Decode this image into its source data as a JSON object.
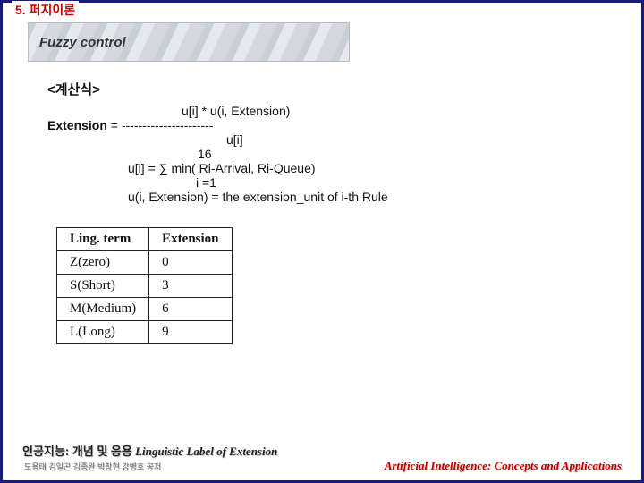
{
  "header": {
    "chapter": "5. 퍼지이론"
  },
  "banner": {
    "subtitle": "Fuzzy control"
  },
  "calc": {
    "title": "<계산식>",
    "line1": "u[i] * u(i, Extension)",
    "line2_label": "Extension",
    "line2_dashes": " = ----------------------",
    "line3": "u[i]",
    "line4": "16",
    "line5": "u[i] = ∑ min( Ri-Arrival, Ri-Queue)",
    "line6": "i =1",
    "line7": "u(i, Extension) = the extension_unit of i-th Rule"
  },
  "table": {
    "headers": [
      "Ling. term",
      "Extension"
    ],
    "rows": [
      {
        "term": "Z(zero)",
        "ext": "0"
      },
      {
        "term": "S(Short)",
        "ext": "3"
      },
      {
        "term": "M(Medium)",
        "ext": "6"
      },
      {
        "term": "L(Long)",
        "ext": "9"
      }
    ]
  },
  "footer": {
    "left_kr": "인공지능: 개념 및 응용",
    "left_en": "Linguistic Label of Extension",
    "left_sub": "도용태 김일곤 김종완 박창현 강병호 공저",
    "right": "Artificial Intelligence: Concepts and Applications"
  }
}
